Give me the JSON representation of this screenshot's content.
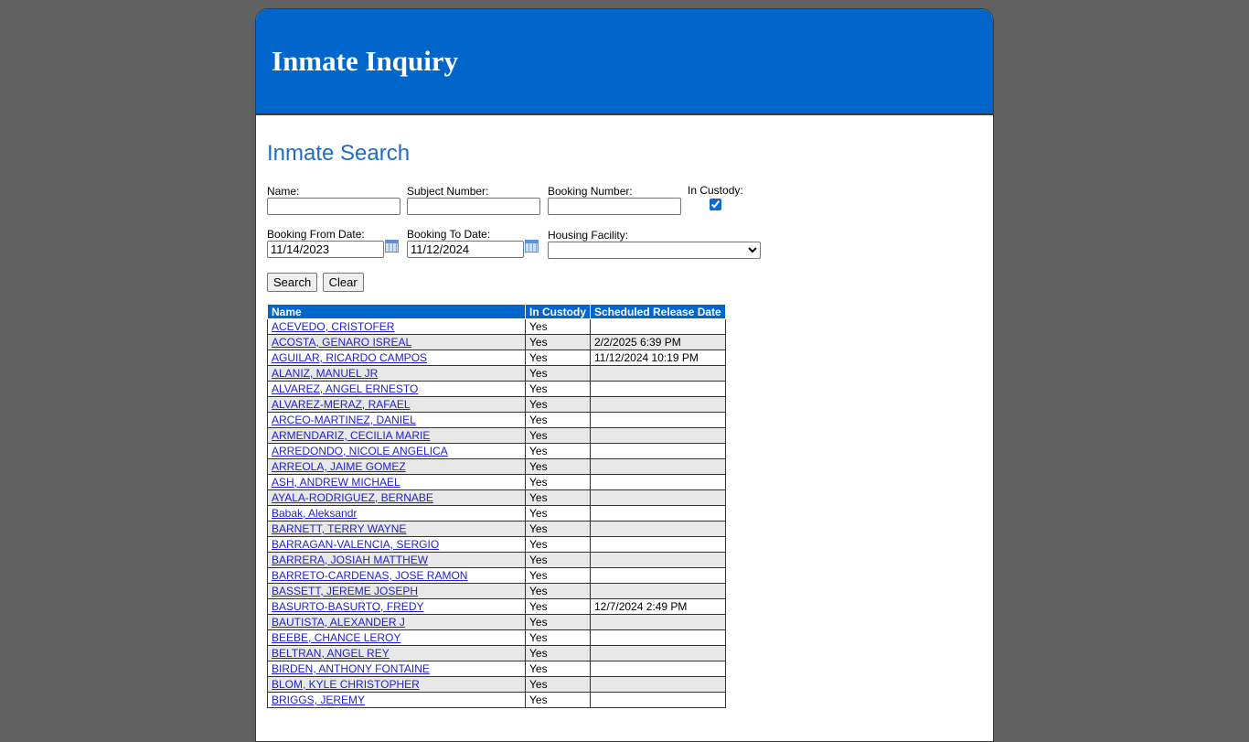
{
  "header": {
    "title": "Inmate Inquiry"
  },
  "search": {
    "title": "Inmate Search",
    "fields": {
      "name": {
        "label": "Name:",
        "value": ""
      },
      "subject_number": {
        "label": "Subject Number:",
        "value": ""
      },
      "booking_number": {
        "label": "Booking Number:",
        "value": ""
      },
      "in_custody": {
        "label": "In Custody:",
        "checked": true
      },
      "booking_from": {
        "label": "Booking From Date:",
        "value": "11/14/2023"
      },
      "booking_to": {
        "label": "Booking To Date:",
        "value": "11/12/2024"
      },
      "housing_facility": {
        "label": "Housing Facility:",
        "selected": ""
      }
    },
    "buttons": {
      "search": "Search",
      "clear": "Clear"
    }
  },
  "results": {
    "columns": [
      "Name",
      "In Custody",
      "Scheduled Release Date"
    ],
    "rows": [
      {
        "name": "ACEVEDO, CRISTOFER",
        "custody": "Yes",
        "release": ""
      },
      {
        "name": "ACOSTA, GENARO ISREAL",
        "custody": "Yes",
        "release": "2/2/2025 6:39 PM"
      },
      {
        "name": "AGUILAR, RICARDO CAMPOS",
        "custody": "Yes",
        "release": "11/12/2024 10:19 PM"
      },
      {
        "name": "ALANIZ, MANUEL JR",
        "custody": "Yes",
        "release": ""
      },
      {
        "name": "ALVAREZ, ANGEL ERNESTO",
        "custody": "Yes",
        "release": ""
      },
      {
        "name": "ALVAREZ-MERAZ, RAFAEL",
        "custody": "Yes",
        "release": ""
      },
      {
        "name": "ARCEO-MARTINEZ, DANIEL",
        "custody": "Yes",
        "release": ""
      },
      {
        "name": "ARMENDARIZ, CECILIA MARIE",
        "custody": "Yes",
        "release": ""
      },
      {
        "name": "ARREDONDO, NICOLE ANGELICA",
        "custody": "Yes",
        "release": ""
      },
      {
        "name": "ARREOLA, JAIME GOMEZ",
        "custody": "Yes",
        "release": ""
      },
      {
        "name": "ASH, ANDREW MICHAEL",
        "custody": "Yes",
        "release": ""
      },
      {
        "name": "AYALA-RODRIGUEZ, BERNABE",
        "custody": "Yes",
        "release": ""
      },
      {
        "name": "Babak, Aleksandr",
        "custody": "Yes",
        "release": ""
      },
      {
        "name": "BARNETT, TERRY WAYNE",
        "custody": "Yes",
        "release": ""
      },
      {
        "name": "BARRAGAN-VALENCIA, SERGIO",
        "custody": "Yes",
        "release": ""
      },
      {
        "name": "BARRERA, JOSIAH MATTHEW",
        "custody": "Yes",
        "release": ""
      },
      {
        "name": "BARRETO-CARDENAS, JOSE RAMON",
        "custody": "Yes",
        "release": ""
      },
      {
        "name": "BASSETT, JEREME JOSEPH",
        "custody": "Yes",
        "release": ""
      },
      {
        "name": "BASURTO-BASURTO, FREDY",
        "custody": "Yes",
        "release": "12/7/2024 2:49 PM"
      },
      {
        "name": "BAUTISTA, ALEXANDER J",
        "custody": "Yes",
        "release": ""
      },
      {
        "name": "BEEBE, CHANCE LEROY",
        "custody": "Yes",
        "release": ""
      },
      {
        "name": "BELTRAN, ANGEL REY",
        "custody": "Yes",
        "release": ""
      },
      {
        "name": "BIRDEN, ANTHONY FONTAINE",
        "custody": "Yes",
        "release": ""
      },
      {
        "name": "BLOM, KYLE CHRISTOPHER",
        "custody": "Yes",
        "release": ""
      },
      {
        "name": "BRIGGS, JEREMY",
        "custody": "Yes",
        "release": ""
      }
    ]
  }
}
